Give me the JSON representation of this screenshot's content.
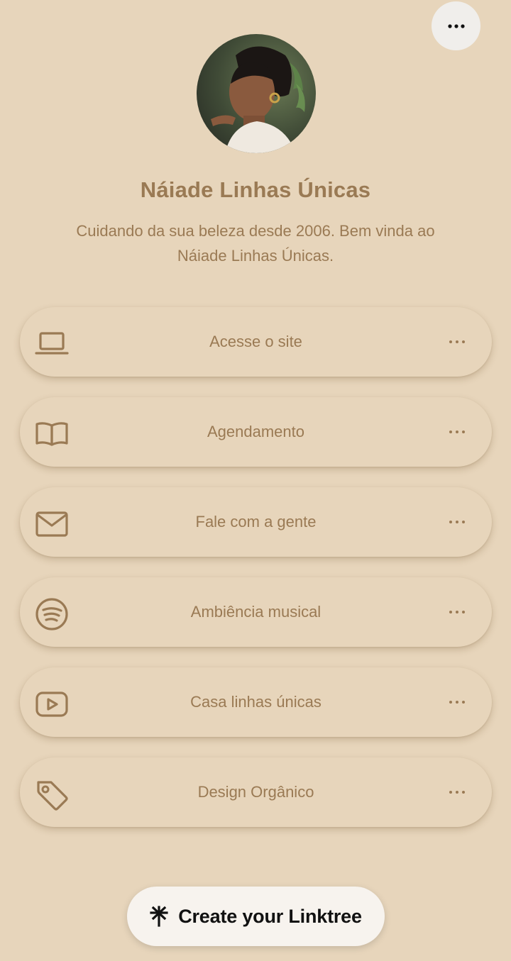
{
  "profile": {
    "name": "Náiade Linhas Únicas",
    "bio": "Cuidando da sua beleza desde 2006. Bem vinda ao Náiade Linhas Únicas."
  },
  "links": [
    {
      "label": "Acesse o site",
      "icon": "laptop-icon"
    },
    {
      "label": "Agendamento",
      "icon": "book-icon"
    },
    {
      "label": "Fale com a gente",
      "icon": "mail-icon"
    },
    {
      "label": "Ambiência musical",
      "icon": "spotify-icon"
    },
    {
      "label": "Casa linhas únicas",
      "icon": "youtube-icon"
    },
    {
      "label": "Design Orgânico",
      "icon": "tag-icon"
    }
  ],
  "cta": {
    "label": "Create your Linktree",
    "icon": "linktree-icon"
  },
  "colors": {
    "background": "#e7d5bb",
    "accent": "#9a7a54",
    "menu_button": "#f0eeeb",
    "cta_background": "#f7f3ee"
  }
}
